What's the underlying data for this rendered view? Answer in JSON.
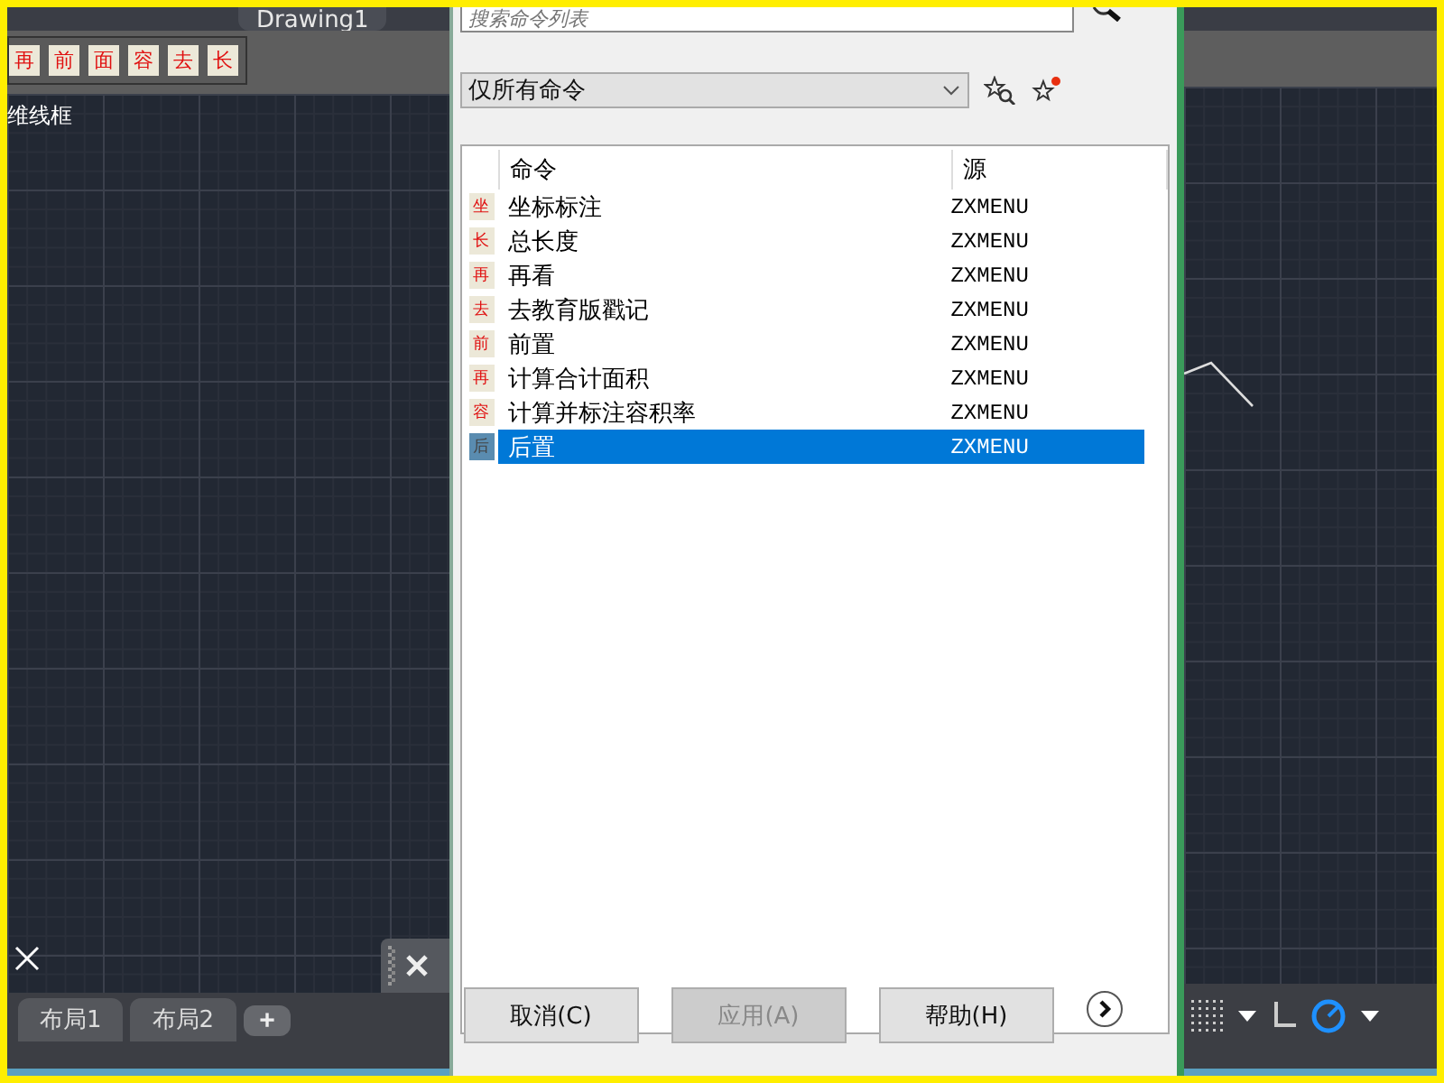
{
  "cad": {
    "drawing_tab": "Drawing1",
    "toolbar_buttons": [
      "再",
      "前",
      "面",
      "容",
      "去",
      "长"
    ],
    "view_label": "维线框",
    "layout_tabs": [
      {
        "label": "布局1",
        "selected": false
      },
      {
        "label": "布局2",
        "selected": false
      }
    ],
    "add_tab": "+"
  },
  "dialog": {
    "search": {
      "placeholder": "搜索命令列表"
    },
    "filter": {
      "value": "仅所有命令"
    },
    "columns": [
      "命令",
      "源"
    ],
    "rows": [
      {
        "icon": "坐",
        "command": "坐标标注",
        "source": "ZXMENU",
        "selected": false
      },
      {
        "icon": "长",
        "command": "总长度",
        "source": "ZXMENU",
        "selected": false
      },
      {
        "icon": "再",
        "command": "再看",
        "source": "ZXMENU",
        "selected": false
      },
      {
        "icon": "去",
        "command": "去教育版戳记",
        "source": "ZXMENU",
        "selected": false
      },
      {
        "icon": "前",
        "command": "前置",
        "source": "ZXMENU",
        "selected": false
      },
      {
        "icon": "再",
        "command": "计算合计面积",
        "source": "ZXMENU",
        "selected": false
      },
      {
        "icon": "容",
        "command": "计算并标注容积率",
        "source": "ZXMENU",
        "selected": false
      },
      {
        "icon": "后",
        "command": "后置",
        "source": "ZXMENU",
        "selected": true
      }
    ],
    "buttons": [
      {
        "label": "取消(C)",
        "disabled": false
      },
      {
        "label": "应用(A)",
        "disabled": true
      },
      {
        "label": "帮助(H)",
        "disabled": false
      }
    ]
  }
}
